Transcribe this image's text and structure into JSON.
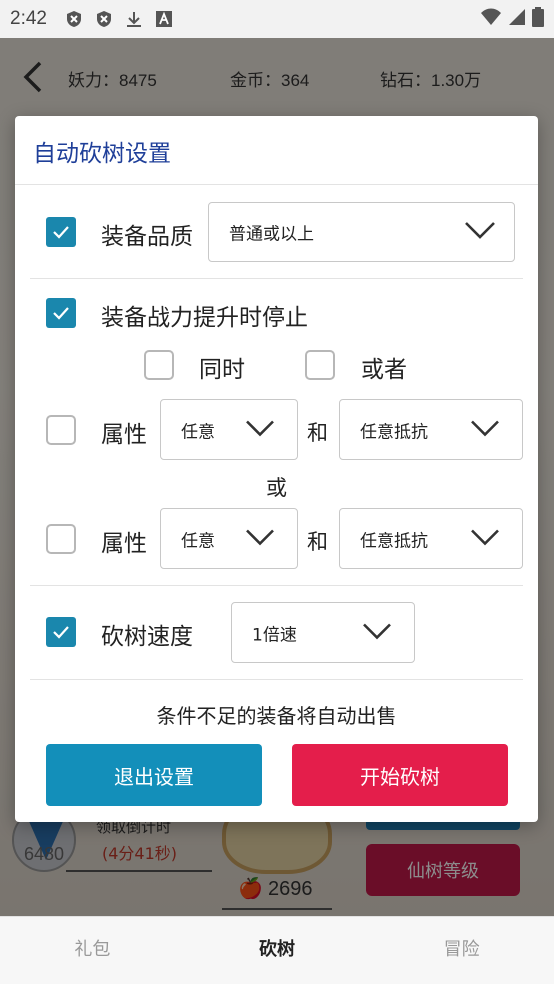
{
  "status_bar": {
    "time": "2:42"
  },
  "game": {
    "stats": {
      "demon_power": "妖力：8475",
      "gold": "金币：364",
      "diamonds": "钻石：1.30万"
    },
    "under": {
      "left_number": "6480",
      "collect_label": "领取倒计时",
      "countdown": "(4分41秒)",
      "apple_count": "2696",
      "xianshu_button": "仙树等级"
    }
  },
  "dialog": {
    "title": "自动砍树设置",
    "quality": {
      "checked": true,
      "label": "装备品质",
      "value": "普通或以上"
    },
    "power_stop": {
      "checked": true,
      "label": "装备战力提升时停止"
    },
    "mode": {
      "simultaneous_label": "同时",
      "simultaneous_checked": false,
      "either_label": "或者",
      "either_checked": false
    },
    "attr1": {
      "checked": false,
      "label": "属性",
      "value1": "任意",
      "and": "和",
      "value2": "任意抵抗"
    },
    "or_label": "或",
    "attr2": {
      "checked": false,
      "label": "属性",
      "value1": "任意",
      "and": "和",
      "value2": "任意抵抗"
    },
    "speed": {
      "checked": true,
      "label": "砍树速度",
      "value": "1倍速"
    },
    "notice": "条件不足的装备将自动出售",
    "exit_button": "退出设置",
    "start_button": "开始砍树"
  },
  "bottom_nav": {
    "items": [
      "礼包",
      "砍树",
      "冒险"
    ],
    "active": "砍树"
  },
  "colors": {
    "accent_teal": "#138fba",
    "accent_red": "#e41e4b",
    "title_blue": "#1f3f99"
  }
}
